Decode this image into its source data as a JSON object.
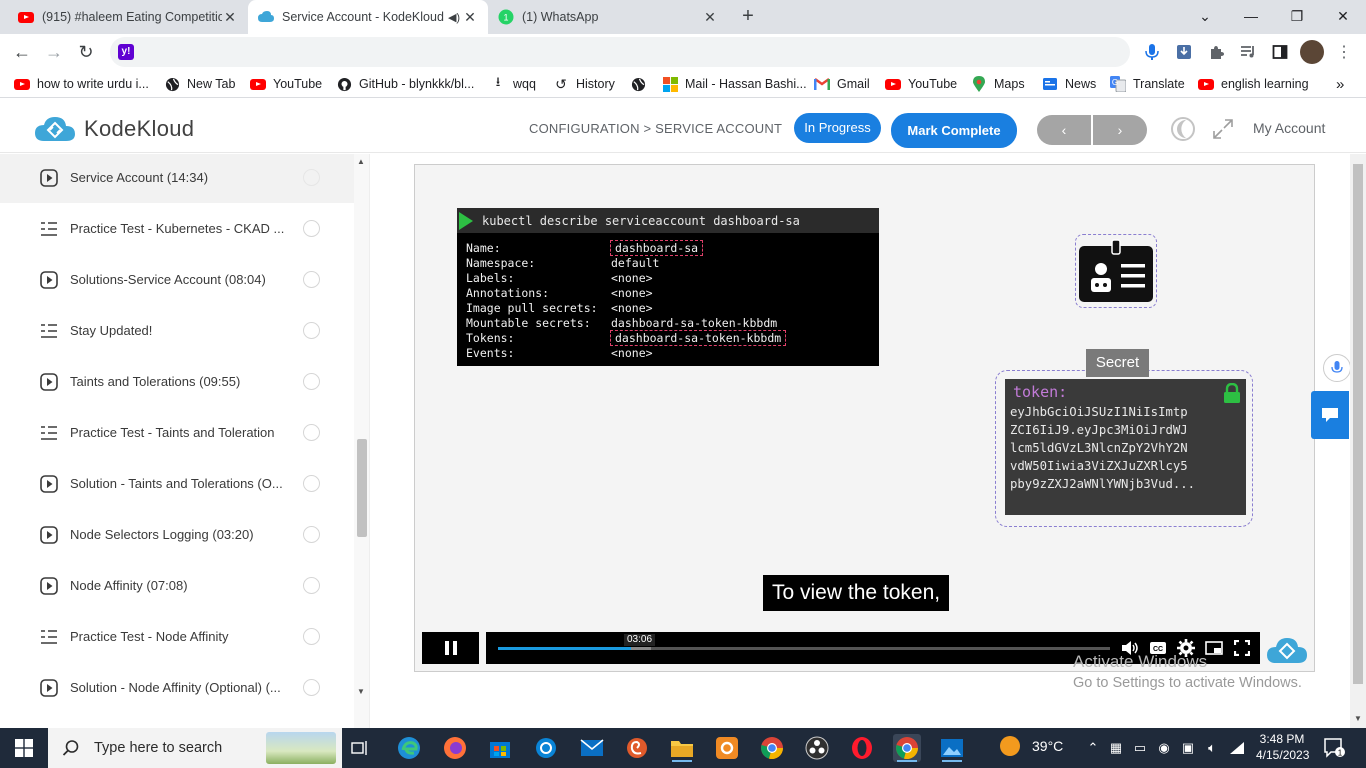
{
  "browser": {
    "tabs": [
      {
        "title": "(915) #haleem Eating Competitio",
        "icon": "youtube-icon"
      },
      {
        "title": "Service Account - KodeKloud",
        "icon": "kodekloud-icon",
        "audio": true
      },
      {
        "title": "(1) WhatsApp",
        "icon": "whatsapp-icon"
      }
    ],
    "address": "",
    "bookmarks": [
      {
        "label": "how to write urdu i...",
        "icon": "youtube-icon"
      },
      {
        "label": "New Tab",
        "icon": "globe-icon"
      },
      {
        "label": "YouTube",
        "icon": "youtube-icon"
      },
      {
        "label": "GitHub - blynkkk/bl...",
        "icon": "github-icon"
      },
      {
        "label": "wqq",
        "icon": "download-icon"
      },
      {
        "label": "History",
        "icon": "history-icon"
      },
      {
        "label": "",
        "icon": "globe-icon"
      },
      {
        "label": "Mail - Hassan Bashi...",
        "icon": "microsoft-icon"
      },
      {
        "label": "Gmail",
        "icon": "gmail-icon"
      },
      {
        "label": "YouTube",
        "icon": "youtube-icon"
      },
      {
        "label": "Maps",
        "icon": "maps-icon"
      },
      {
        "label": "News",
        "icon": "news-icon"
      },
      {
        "label": "Translate",
        "icon": "translate-icon"
      },
      {
        "label": "english learning",
        "icon": "youtube-icon"
      }
    ]
  },
  "header": {
    "brand": "KodeKloud",
    "breadcrumb": "CONFIGURATION > SERVICE ACCOUNT",
    "status": "In Progress",
    "mark_complete": "Mark Complete",
    "prev": "‹",
    "next": "›",
    "account": "My Account"
  },
  "sidebar": {
    "items": [
      {
        "label": "Service Account (14:34)",
        "type": "video",
        "selected": true
      },
      {
        "label": "Practice Test - Kubernetes - CKAD ...",
        "type": "lab"
      },
      {
        "label": "Solutions-Service Account (08:04)",
        "type": "video"
      },
      {
        "label": "Stay Updated!",
        "type": "lab"
      },
      {
        "label": "Taints and Tolerations (09:55)",
        "type": "video"
      },
      {
        "label": "Practice Test - Taints and Toleration",
        "type": "lab"
      },
      {
        "label": "Solution - Taints and Tolerations (O...",
        "type": "video"
      },
      {
        "label": "Node Selectors Logging (03:20)",
        "type": "video"
      },
      {
        "label": "Node Affinity (07:08)",
        "type": "video"
      },
      {
        "label": "Practice Test - Node Affinity",
        "type": "lab"
      },
      {
        "label": "Solution - Node Affinity (Optional) (...",
        "type": "video"
      }
    ]
  },
  "video": {
    "terminal_command": "kubectl describe serviceaccount dashboard-sa",
    "terminal_rows": [
      {
        "key": "Name:",
        "value": "dashboard-sa"
      },
      {
        "key": "Namespace:",
        "value": "default"
      },
      {
        "key": "Labels:",
        "value": "<none>"
      },
      {
        "key": "Annotations:",
        "value": "<none>"
      },
      {
        "key": "Image pull secrets:",
        "value": "<none>"
      },
      {
        "key": "Mountable secrets:",
        "value": "dashboard-sa-token-kbbdm"
      },
      {
        "key": "Tokens:",
        "value": "dashboard-sa-token-kbbdm"
      },
      {
        "key": "Events:",
        "value": "<none>"
      }
    ],
    "secret_label": "Secret",
    "token_label": "token:",
    "token_lines": [
      "eyJhbGciOiJSUzI1NiIsImtp",
      "ZCI6IiJ9.eyJpc3MiOiJrdWJ",
      "lcm5ldGVzL3NlcnZpY2VhY2N",
      "vdW50Iiwia3ViZXJuZXRlcy5",
      "pby9zZXJ2aWNlYWNjb3Vud..."
    ],
    "caption": "To view the token,",
    "current_time": "03:06",
    "progress": 0.217,
    "buffered": 0.25
  },
  "watermark": {
    "line1": "Activate Windows",
    "line2": "Go to Settings to activate Windows."
  },
  "taskbar": {
    "search_placeholder": "Type here to search",
    "weather": "39°C",
    "time": "3:48 PM",
    "date": "4/15/2023",
    "notifications": "1"
  }
}
